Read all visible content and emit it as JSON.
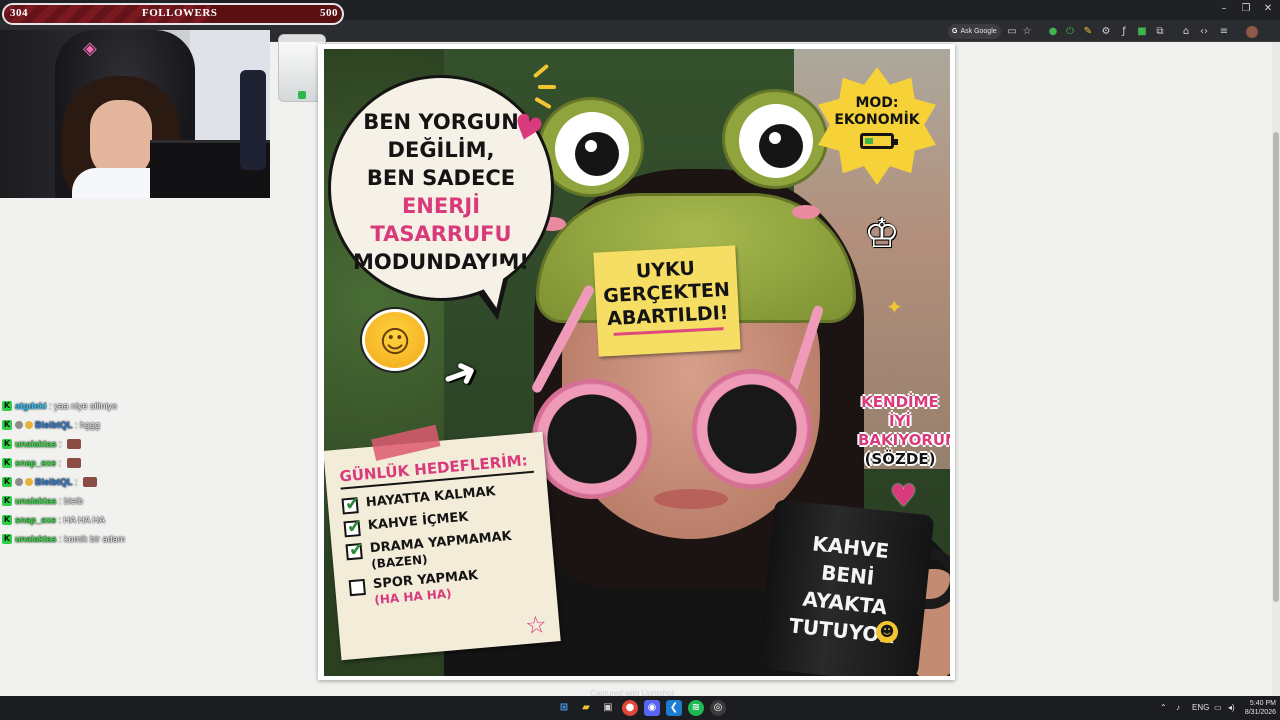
{
  "window": {
    "controls": [
      "–",
      "❐",
      "✕"
    ]
  },
  "toolbar": {
    "ask_google_label": "Ask Google",
    "icons": [
      "screen-icon",
      "star-icon",
      "extension-shield-icon",
      "power-icon",
      "pen-icon",
      "gear-icon",
      "function-icon",
      "green-extension-icon",
      "puzzle-icon",
      "home-icon",
      "code-icon",
      "menu-icon",
      "profile-avatar"
    ]
  },
  "follower_goal": {
    "current": "304",
    "label": "FOLLOWERS",
    "target": "500",
    "progress_fraction": 0.608
  },
  "chat": [
    {
      "user": "atgdeki",
      "color": "#2ec4ff",
      "message": "yaa niye siliniyo",
      "emote": false,
      "extra_badge": false
    },
    {
      "user": "BleibtQL",
      "color": "#2e7bd8",
      "message": "hggg",
      "emote": false,
      "extra_badge": true
    },
    {
      "user": "unalaktas",
      "color": "#3fe04d",
      "message": "",
      "emote": true,
      "extra_badge": false
    },
    {
      "user": "snap_exe",
      "color": "#3fe04d",
      "message": "",
      "emote": true,
      "extra_badge": false
    },
    {
      "user": "BleibtQL",
      "color": "#2e7bd8",
      "message": "",
      "emote": true,
      "extra_badge": true
    },
    {
      "user": "unalaktas",
      "color": "#3fe04d",
      "message": "bleib",
      "emote": false,
      "extra_badge": false
    },
    {
      "user": "snap_exe",
      "color": "#3fe04d",
      "message": "HA HA HA",
      "emote": false,
      "extra_badge": false
    },
    {
      "user": "unalaktas",
      "color": "#3fe04d",
      "message": "komik bir adam",
      "emote": false,
      "extra_badge": false
    }
  ],
  "image": {
    "bubble_lines": [
      "BEN YORGUN",
      "DEĞİLİM,",
      "BEN SADECE"
    ],
    "bubble_pink": "ENERJİ TASARRUFU",
    "bubble_last": "MODUNDAYIM!",
    "mod_lines": [
      "MOD:",
      "EKONOMİK"
    ],
    "sticky_lines": [
      "UYKU",
      "GERÇEKTEN",
      "ABARTILDI!"
    ],
    "side_lines": [
      "KENDİME",
      "İYİ",
      "BAKIYORUM",
      "(SÖZDE)"
    ],
    "note_title": "GÜNLÜK HEDEFLERİM:",
    "todos": [
      {
        "text": "HAYATTA KALMAK",
        "checked": true,
        "sub": ""
      },
      {
        "text": "KAHVE İÇMEK",
        "checked": true,
        "sub": ""
      },
      {
        "text": "DRAMA YAPMAMAK",
        "checked": true,
        "sub": "(BAZEN)"
      },
      {
        "text": "SPOR YAPMAK",
        "checked": false,
        "sub": "(HA HA HA)"
      }
    ],
    "mug_lines": [
      "KAHVE",
      "BENİ",
      "AYAKTA",
      "TUTUYOR"
    ]
  },
  "captured_text": "Captured with Lightshot",
  "taskbar": {
    "apps": [
      "windows-start-icon",
      "file-explorer-icon",
      "store-icon",
      "chrome-icon",
      "discord-icon",
      "vscode-icon",
      "spotify-icon",
      "obs-icon"
    ],
    "lang": "ENG",
    "time": "5:40 PM",
    "date": "8/31/2026"
  },
  "colors": {
    "accent_pink": "#d93a7b",
    "kick_green": "#2fcf45",
    "follower_bar": "#5a0f13"
  }
}
